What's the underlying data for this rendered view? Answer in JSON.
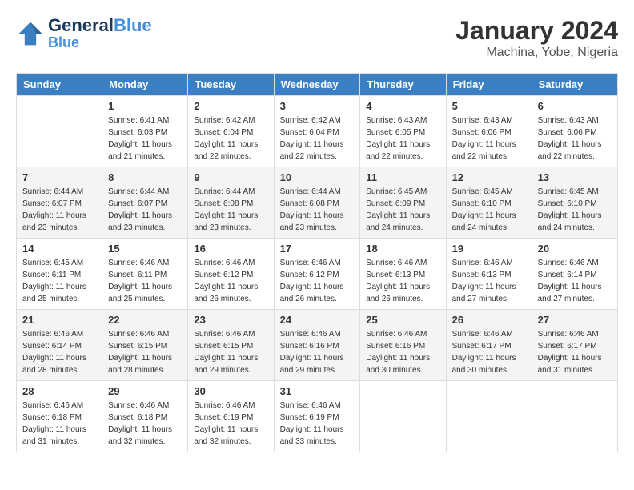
{
  "header": {
    "logo_line1": "General",
    "logo_line2": "Blue",
    "month": "January 2024",
    "location": "Machina, Yobe, Nigeria"
  },
  "weekdays": [
    "Sunday",
    "Monday",
    "Tuesday",
    "Wednesday",
    "Thursday",
    "Friday",
    "Saturday"
  ],
  "weeks": [
    [
      {
        "day": "",
        "info": ""
      },
      {
        "day": "1",
        "info": "Sunrise: 6:41 AM\nSunset: 6:03 PM\nDaylight: 11 hours\nand 21 minutes."
      },
      {
        "day": "2",
        "info": "Sunrise: 6:42 AM\nSunset: 6:04 PM\nDaylight: 11 hours\nand 22 minutes."
      },
      {
        "day": "3",
        "info": "Sunrise: 6:42 AM\nSunset: 6:04 PM\nDaylight: 11 hours\nand 22 minutes."
      },
      {
        "day": "4",
        "info": "Sunrise: 6:43 AM\nSunset: 6:05 PM\nDaylight: 11 hours\nand 22 minutes."
      },
      {
        "day": "5",
        "info": "Sunrise: 6:43 AM\nSunset: 6:06 PM\nDaylight: 11 hours\nand 22 minutes."
      },
      {
        "day": "6",
        "info": "Sunrise: 6:43 AM\nSunset: 6:06 PM\nDaylight: 11 hours\nand 22 minutes."
      }
    ],
    [
      {
        "day": "7",
        "info": "Sunrise: 6:44 AM\nSunset: 6:07 PM\nDaylight: 11 hours\nand 23 minutes."
      },
      {
        "day": "8",
        "info": "Sunrise: 6:44 AM\nSunset: 6:07 PM\nDaylight: 11 hours\nand 23 minutes."
      },
      {
        "day": "9",
        "info": "Sunrise: 6:44 AM\nSunset: 6:08 PM\nDaylight: 11 hours\nand 23 minutes."
      },
      {
        "day": "10",
        "info": "Sunrise: 6:44 AM\nSunset: 6:08 PM\nDaylight: 11 hours\nand 23 minutes."
      },
      {
        "day": "11",
        "info": "Sunrise: 6:45 AM\nSunset: 6:09 PM\nDaylight: 11 hours\nand 24 minutes."
      },
      {
        "day": "12",
        "info": "Sunrise: 6:45 AM\nSunset: 6:10 PM\nDaylight: 11 hours\nand 24 minutes."
      },
      {
        "day": "13",
        "info": "Sunrise: 6:45 AM\nSunset: 6:10 PM\nDaylight: 11 hours\nand 24 minutes."
      }
    ],
    [
      {
        "day": "14",
        "info": "Sunrise: 6:45 AM\nSunset: 6:11 PM\nDaylight: 11 hours\nand 25 minutes."
      },
      {
        "day": "15",
        "info": "Sunrise: 6:46 AM\nSunset: 6:11 PM\nDaylight: 11 hours\nand 25 minutes."
      },
      {
        "day": "16",
        "info": "Sunrise: 6:46 AM\nSunset: 6:12 PM\nDaylight: 11 hours\nand 26 minutes."
      },
      {
        "day": "17",
        "info": "Sunrise: 6:46 AM\nSunset: 6:12 PM\nDaylight: 11 hours\nand 26 minutes."
      },
      {
        "day": "18",
        "info": "Sunrise: 6:46 AM\nSunset: 6:13 PM\nDaylight: 11 hours\nand 26 minutes."
      },
      {
        "day": "19",
        "info": "Sunrise: 6:46 AM\nSunset: 6:13 PM\nDaylight: 11 hours\nand 27 minutes."
      },
      {
        "day": "20",
        "info": "Sunrise: 6:46 AM\nSunset: 6:14 PM\nDaylight: 11 hours\nand 27 minutes."
      }
    ],
    [
      {
        "day": "21",
        "info": "Sunrise: 6:46 AM\nSunset: 6:14 PM\nDaylight: 11 hours\nand 28 minutes."
      },
      {
        "day": "22",
        "info": "Sunrise: 6:46 AM\nSunset: 6:15 PM\nDaylight: 11 hours\nand 28 minutes."
      },
      {
        "day": "23",
        "info": "Sunrise: 6:46 AM\nSunset: 6:15 PM\nDaylight: 11 hours\nand 29 minutes."
      },
      {
        "day": "24",
        "info": "Sunrise: 6:46 AM\nSunset: 6:16 PM\nDaylight: 11 hours\nand 29 minutes."
      },
      {
        "day": "25",
        "info": "Sunrise: 6:46 AM\nSunset: 6:16 PM\nDaylight: 11 hours\nand 30 minutes."
      },
      {
        "day": "26",
        "info": "Sunrise: 6:46 AM\nSunset: 6:17 PM\nDaylight: 11 hours\nand 30 minutes."
      },
      {
        "day": "27",
        "info": "Sunrise: 6:46 AM\nSunset: 6:17 PM\nDaylight: 11 hours\nand 31 minutes."
      }
    ],
    [
      {
        "day": "28",
        "info": "Sunrise: 6:46 AM\nSunset: 6:18 PM\nDaylight: 11 hours\nand 31 minutes."
      },
      {
        "day": "29",
        "info": "Sunrise: 6:46 AM\nSunset: 6:18 PM\nDaylight: 11 hours\nand 32 minutes."
      },
      {
        "day": "30",
        "info": "Sunrise: 6:46 AM\nSunset: 6:19 PM\nDaylight: 11 hours\nand 32 minutes."
      },
      {
        "day": "31",
        "info": "Sunrise: 6:46 AM\nSunset: 6:19 PM\nDaylight: 11 hours\nand 33 minutes."
      },
      {
        "day": "",
        "info": ""
      },
      {
        "day": "",
        "info": ""
      },
      {
        "day": "",
        "info": ""
      }
    ]
  ]
}
